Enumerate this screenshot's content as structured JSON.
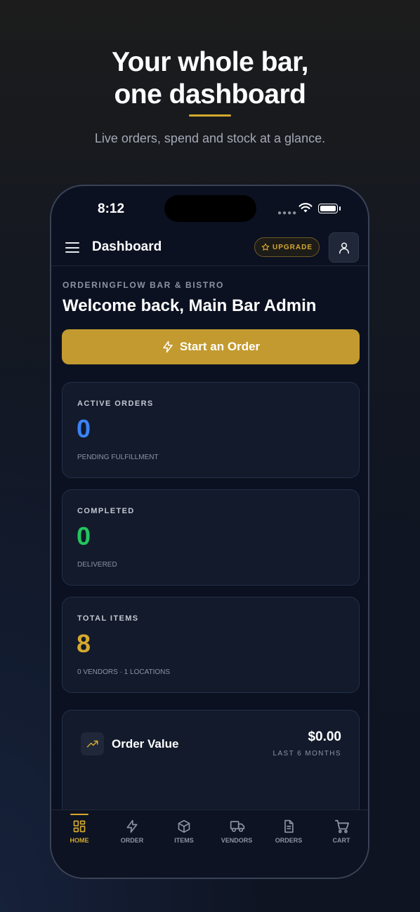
{
  "hero": {
    "title_line1": "Your whole bar,",
    "title_line2": "one dashboard",
    "subtitle": "Live orders, spend and stock at a glance."
  },
  "status_bar": {
    "time": "8:12"
  },
  "header": {
    "title": "Dashboard",
    "upgrade_label": "UPGRADE"
  },
  "welcome": {
    "business_name": "ORDERINGFLOW BAR & BISTRO",
    "greeting": "Welcome back, Main Bar Admin",
    "start_order_label": "Start an Order"
  },
  "stats": [
    {
      "label": "ACTIVE ORDERS",
      "value": "0",
      "caption": "PENDING FULFILLMENT",
      "color": "#3b82f6"
    },
    {
      "label": "COMPLETED",
      "value": "0",
      "caption": "DELIVERED",
      "color": "#22c55e"
    },
    {
      "label": "TOTAL ITEMS",
      "value": "8",
      "caption": "0 VENDORS · 1 LOCATIONS",
      "color": "#d4a92e"
    }
  ],
  "order_value": {
    "title": "Order Value",
    "amount": "$0.00",
    "range": "LAST 6 MONTHS"
  },
  "tabs": [
    {
      "label": "HOME",
      "icon": "home-grid-icon",
      "active": true
    },
    {
      "label": "ORDER",
      "icon": "bolt-icon"
    },
    {
      "label": "ITEMS",
      "icon": "box-icon"
    },
    {
      "label": "VENDORS",
      "icon": "truck-icon"
    },
    {
      "label": "ORDERS",
      "icon": "document-icon"
    },
    {
      "label": "CART",
      "icon": "cart-icon"
    }
  ],
  "colors": {
    "accent": "#d4a92e",
    "button": "#c39a2f",
    "background": "#0b1120"
  }
}
